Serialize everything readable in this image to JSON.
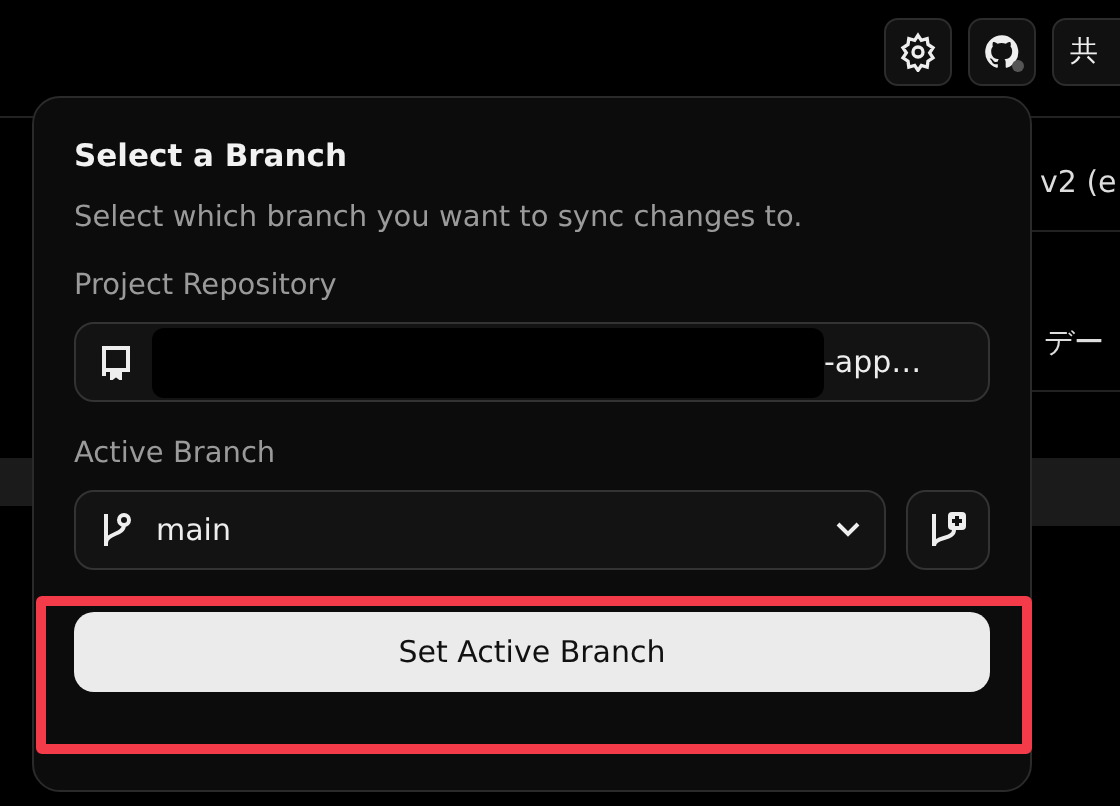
{
  "header": {
    "share_button": "共"
  },
  "background": {
    "texts": [
      "v2 (e",
      "デー"
    ]
  },
  "popover": {
    "title": "Select a Branch",
    "description": "Select which branch you want to sync changes to.",
    "repository": {
      "label": "Project Repository",
      "value": "-app…",
      "redacted": true
    },
    "branch": {
      "label": "Active Branch",
      "value": "main"
    },
    "submit": "Set Active Branch",
    "highlighted": true
  }
}
